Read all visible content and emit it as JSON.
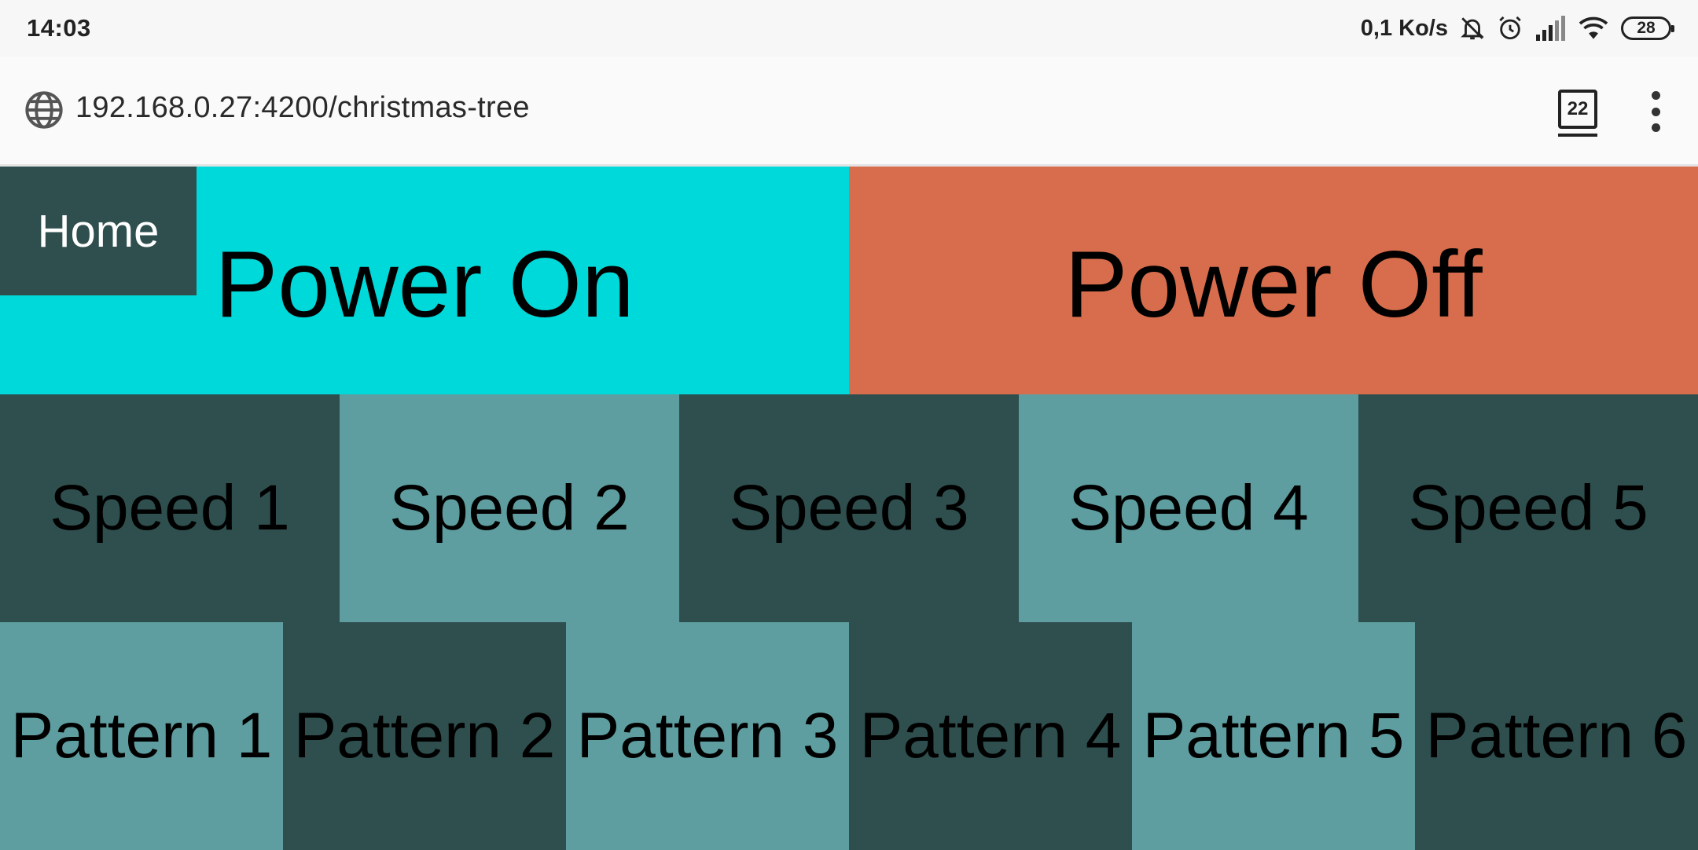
{
  "status_bar": {
    "time": "14:03",
    "net_speed": "0,1 Ko/s",
    "icons": [
      "bell-muted-icon",
      "alarm-icon",
      "signal-icon",
      "wifi-icon",
      "battery-icon"
    ],
    "battery": "28"
  },
  "browser": {
    "url": "192.168.0.27:4200/christmas-tree",
    "tab_count": "22",
    "icons": [
      "globe-icon",
      "tabs-icon",
      "menu-icon"
    ]
  },
  "page": {
    "home_label": "Home",
    "power_on_label": "Power On",
    "power_off_label": "Power Off",
    "speeds": [
      "Speed 1",
      "Speed 2",
      "Speed 3",
      "Speed 4",
      "Speed 5"
    ],
    "patterns": [
      "Pattern 1",
      "Pattern 2",
      "Pattern 3",
      "Pattern 4",
      "Pattern 5",
      "Pattern 6"
    ]
  },
  "colors": {
    "power_on": "#00d9d9",
    "power_off": "#d76d4c",
    "dark_slate": "#2f4f4f",
    "cadet_blue": "#5f9ea0",
    "home_text": "#ffffff",
    "button_text": "#000000"
  }
}
